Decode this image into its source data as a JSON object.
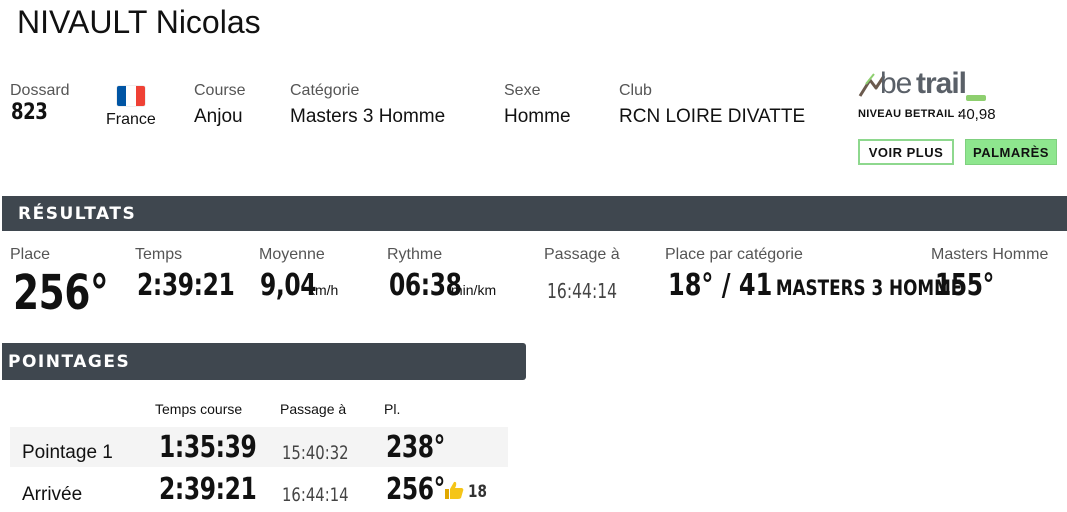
{
  "athlete": {
    "name": "NIVAULT Nicolas"
  },
  "info": {
    "dossard_label": "Dossard",
    "dossard_value": "823",
    "country": "France",
    "course_label": "Course",
    "course_value": "Anjou",
    "categorie_label": "Catégorie",
    "categorie_value": "Masters 3 Homme",
    "sexe_label": "Sexe",
    "sexe_value": "Homme",
    "club_label": "Club",
    "club_value": "RCN LOIRE DIVATTE"
  },
  "betrail": {
    "logo_text_be": "be",
    "logo_text_trail": "trail",
    "niveau_label": "NIVEAU BETRAIL :",
    "niveau_value": "40,98",
    "voir_plus": "VOIR PLUS",
    "palmares": "PALMARÈS"
  },
  "resultats": {
    "heading": "RÉSULTATS",
    "place_label": "Place",
    "place_value": "256°",
    "temps_label": "Temps",
    "temps_value": "2:39:21",
    "moyenne_label": "Moyenne",
    "moyenne_value": "9,04",
    "moyenne_unit": "km/h",
    "rythme_label": "Rythme",
    "rythme_value": "06:38",
    "rythme_unit": "min/km",
    "passage_label": "Passage à",
    "passage_value": "16:44:14",
    "place_cat_label": "Place par catégorie",
    "place_cat_value": "18° / 41",
    "place_cat_name": "MASTERS 3 HOMME",
    "masters_label": "Masters Homme",
    "masters_value": "155°"
  },
  "pointages": {
    "heading": "POINTAGES",
    "columns": [
      "Temps course",
      "Passage à",
      "Pl."
    ],
    "rows": [
      {
        "name": "Pointage 1",
        "temps": "1:35:39",
        "passage": "15:40:32",
        "place": "238°",
        "gain": ""
      },
      {
        "name": "Arrivée",
        "temps": "2:39:21",
        "passage": "16:44:14",
        "place": "256°",
        "gain": "18"
      }
    ]
  },
  "colors": {
    "bar": "#3f474f",
    "accent_green": "#8ee68e",
    "flag_blue": "#0055A4",
    "flag_red": "#EF4135",
    "gain_icon": "#f5c518"
  }
}
